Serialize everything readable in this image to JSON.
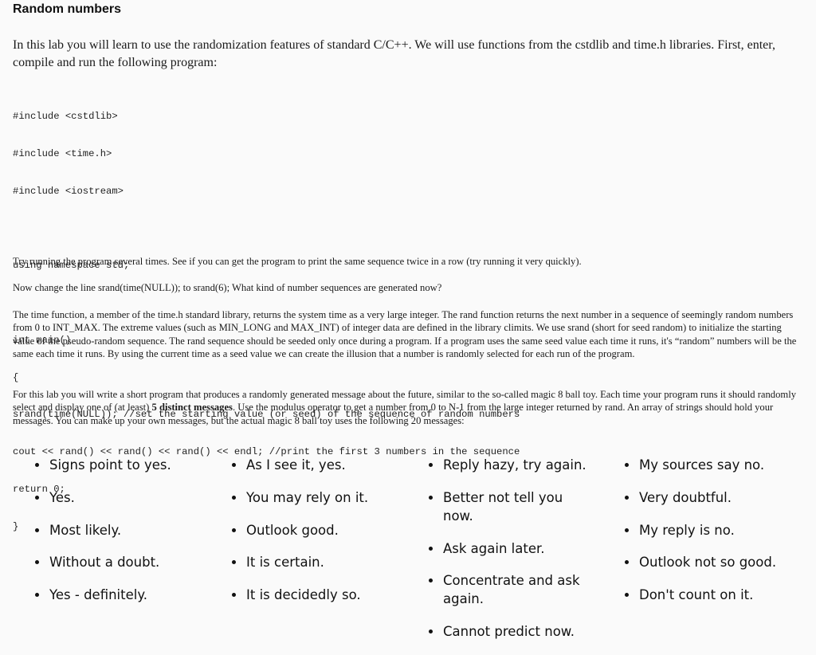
{
  "title": "Random numbers",
  "intro": "In this lab you will learn to use the randomization features of standard C/C++. We will use functions from the cstdlib and time.h libraries. First, enter, compile and run the following program:",
  "code_lines": [
    "#include <cstdlib>",
    "#include <time.h>",
    "#include <iostream>",
    "",
    "using namespace std;",
    "",
    "int main()",
    "{",
    "srand(time(NULL)); //set the starting value (or seed) of the sequence of random numbers",
    "cout << rand() << rand() << rand() << endl; //print the first 3 numbers in the sequence",
    "return 0;",
    "}"
  ],
  "para_try": "Try running the program several times. See if you can get the program to print the same sequence twice in a row (try running it very quickly).",
  "para_change": "Now change the line srand(time(NULL)); to srand(6); What kind of number sequences are generated now?",
  "para_time": "The time function, a member of the time.h standard library, returns the system time as a very large integer. The rand function returns the next number in a sequence of seemingly random numbers from 0 to INT_MAX. The extreme values (such as MIN_LONG and MAX_INT) of integer data are defined in the library climits. We use srand (short for seed random) to initialize the starting value of the pseudo-random sequence. The rand sequence should be seeded only once during a program. If a program uses the same seed value each time it runs, it's “random” numbers will be the same each time it runs. By using the current time as a seed value we can create the illusion that a number is randomly selected for each run of the program.",
  "para_lab": {
    "before": "For this lab you will write a short program that produces a randomly generated message about the future, similar to the so-called magic 8 ball toy. Each time your program runs it should randomly select and display one of (at least) ",
    "bold": "5 distinct messages",
    "after": ". Use the modulus operator to get a number from 0 to N-1 from the large integer returned by rand. An array of strings should hold your messages. You can make up your own messages, but the actual magic 8 ball toy uses the following 20 messages:"
  },
  "messages": [
    [
      "Signs point to yes.",
      "Yes.",
      "Most likely.",
      "Without a doubt.",
      "Yes - definitely."
    ],
    [
      "As I see it, yes.",
      "You may rely on it.",
      "Outlook good.",
      "It is certain.",
      "It is decidedly so."
    ],
    [
      "Reply hazy, try again.",
      "Better not tell you now.",
      "Ask again later.",
      "Concentrate and ask again.",
      "Cannot predict now."
    ],
    [
      "My sources say no.",
      "Very doubtful.",
      "My reply is no.",
      "Outlook not so good.",
      "Don't count on it."
    ]
  ]
}
